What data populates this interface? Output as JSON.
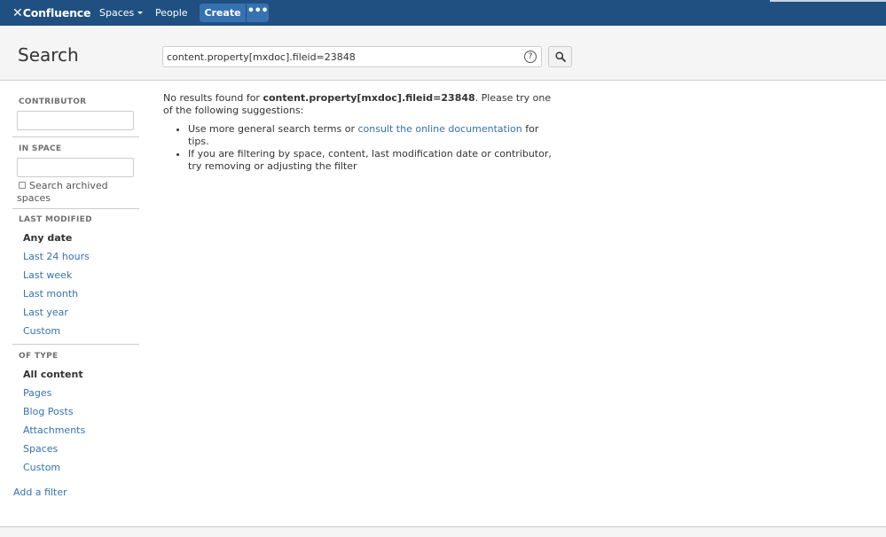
{
  "nav": {
    "logo_text": "Confluence",
    "spaces_label": "Spaces",
    "people_label": "People",
    "create_label": "Create",
    "more_label": "•••"
  },
  "header": {
    "title": "Search",
    "query": "content.property[mxdoc].fileid=23848",
    "help_icon": "?"
  },
  "sidebar": {
    "contributor_label": "CONTRIBUTOR",
    "contributor_value": "",
    "in_space_label": "IN SPACE",
    "in_space_value": "",
    "archived_label": "Search archived spaces",
    "last_modified_label": "LAST MODIFIED",
    "last_modified_options": [
      "Any date",
      "Last 24 hours",
      "Last week",
      "Last month",
      "Last year",
      "Custom"
    ],
    "of_type_label": "OF TYPE",
    "of_type_options": [
      "All content",
      "Pages",
      "Blog Posts",
      "Attachments",
      "Spaces",
      "Custom"
    ],
    "add_filter_label": "Add a filter"
  },
  "results": {
    "prefix": "No results found for ",
    "query": "content.property[mxdoc].fileid=23848",
    "suffix": ". Please try one of the following suggestions:",
    "suggestion1_prefix": "Use more general search terms or ",
    "suggestion1_link": "consult the online documentation",
    "suggestion1_suffix": " for tips.",
    "suggestion2": "If you are filtering by space, content, last modification date or contributor, try removing or adjusting the filter"
  }
}
